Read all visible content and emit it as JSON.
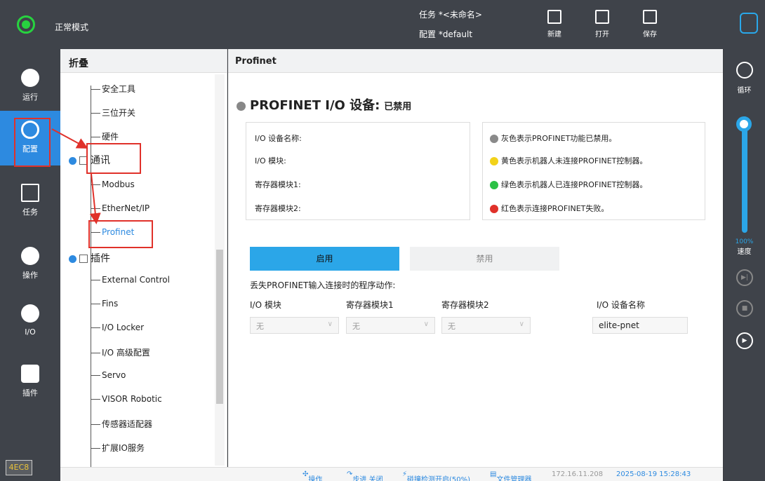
{
  "topbar": {
    "mode": "正常模式",
    "task": "任务  *<未命名>",
    "config": "配置  *default",
    "new_label": "新建",
    "open_label": "打开",
    "save_label": "保存"
  },
  "left_rail": {
    "run": "运行",
    "config": "配置",
    "task": "任务",
    "ops": "操作",
    "io": "I/O",
    "plugin": "插件",
    "version": "4EC8"
  },
  "tree": {
    "header": "折叠",
    "items": [
      "安全工具",
      "三位开关",
      "硬件"
    ],
    "comm_category": "通讯",
    "comm_items": [
      "Modbus",
      "EtherNet/IP",
      "Profinet"
    ],
    "plugin_category": "插件",
    "plugin_items": [
      "External Control",
      "Fins",
      "I/O Locker",
      "I/O 高级配置",
      "Servo",
      "VISOR Robotic",
      "传感器适配器",
      "扩展IO服务"
    ]
  },
  "main": {
    "header": "Profinet",
    "device_title": "PROFINET I/O 设备:",
    "device_status": "已禁用",
    "info_labels": [
      "I/O 设备名称:",
      "I/O 模块:",
      "寄存器模块1:",
      "寄存器模块2:"
    ],
    "legend": [
      {
        "text": "灰色表示PROFINET功能已禁用。",
        "color": "#8a8a8a"
      },
      {
        "text": "黄色表示机器人未连接PROFINET控制器。",
        "color": "#f2d21a"
      },
      {
        "text": "绿色表示机器人已连接PROFINET控制器。",
        "color": "#2cc146"
      },
      {
        "text": "红色表示连接PROFINET失败。",
        "color": "#e0312a"
      }
    ],
    "enable_label": "启用",
    "disable_label": "禁用",
    "loss_label": "丢失PROFINET输入连接时的程序动作:",
    "col_io_module": "I/O 模块",
    "col_reg1": "寄存器模块1",
    "col_reg2": "寄存器模块2",
    "col_devname": "I/O 设备名称",
    "select_value": "无",
    "devname_value": "elite-pnet"
  },
  "right_rail": {
    "loop": "循环",
    "speed_pct": "100%",
    "speed_label": "速度",
    "speed_value": 1.0
  },
  "statusbar": {
    "ops": "操作",
    "step": "步进 关闭",
    "collision": "碰撞检测开启(50%)",
    "filemgr": "文件管理器",
    "ip": "172.16.11.208",
    "datetime": "2025-08-19 15:28:43"
  },
  "colors": {
    "accent": "#2d8ae0",
    "enable_button": "#2ba6e8",
    "status_green": "#27d33f",
    "annotation_red": "#e0312a"
  }
}
